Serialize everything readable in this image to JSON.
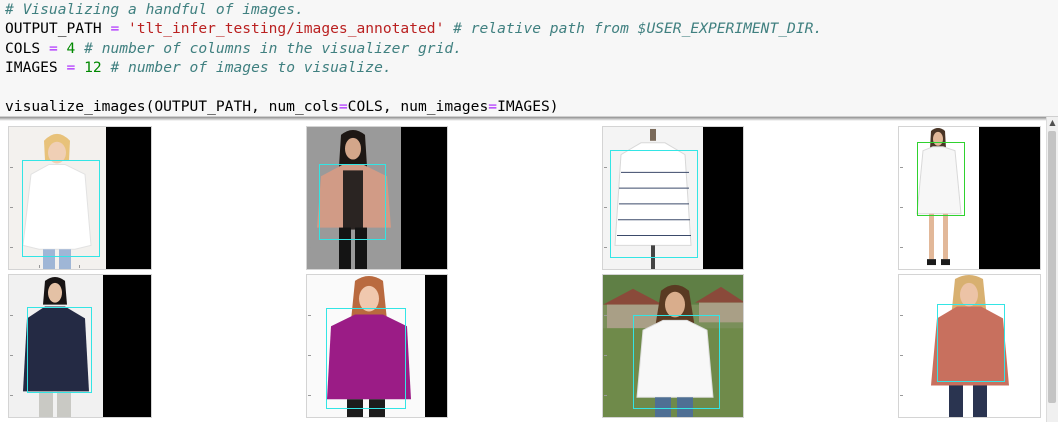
{
  "notebook": {
    "code_cell": {
      "line1_comment": "# Visualizing a handful of images.",
      "line2": {
        "var": "OUTPUT_PATH",
        "eq": "=",
        "string": "'tlt_infer_testing/images_annotated'",
        "comment": "# relative path from $USER_EXPERIMENT_DIR."
      },
      "line3": {
        "var": "COLS",
        "eq": "=",
        "number": "4",
        "comment": "# number of columns in the visualizer grid."
      },
      "line4": {
        "var": "IMAGES",
        "eq": "=",
        "number": "12",
        "comment": "# number of images to visualize."
      },
      "line6": {
        "func": "visualize_images(OUTPUT_PATH, num_cols",
        "eq1": "=",
        "mid": "COLS, num_images",
        "eq2": "=",
        "end": "IMAGES)"
      }
    },
    "output": {
      "images": [
        {
          "name": "blonde-woman-white-blouse",
          "bbox_color": "#33e5e5"
        },
        {
          "name": "woman-pink-cardigan-necklace",
          "bbox_color": "#33e5e5"
        },
        {
          "name": "striped-shirt-on-mannequin",
          "bbox_color": "#33e5e5"
        },
        {
          "name": "woman-white-dress",
          "bbox_color": "#2fd22f"
        },
        {
          "name": "woman-navy-wrap-top",
          "bbox_color": "#33e5e5"
        },
        {
          "name": "woman-magenta-blouse",
          "bbox_color": "#33e5e5"
        },
        {
          "name": "woman-white-shirt-outdoors",
          "bbox_color": "#33e5e5"
        },
        {
          "name": "woman-rust-pleated-top",
          "bbox_color": "#33e5e5"
        }
      ]
    }
  },
  "colors": {
    "comment": "#408080",
    "operator": "#aa22ff",
    "string": "#ba2121",
    "number": "#008800",
    "black_bar": "#000000"
  }
}
